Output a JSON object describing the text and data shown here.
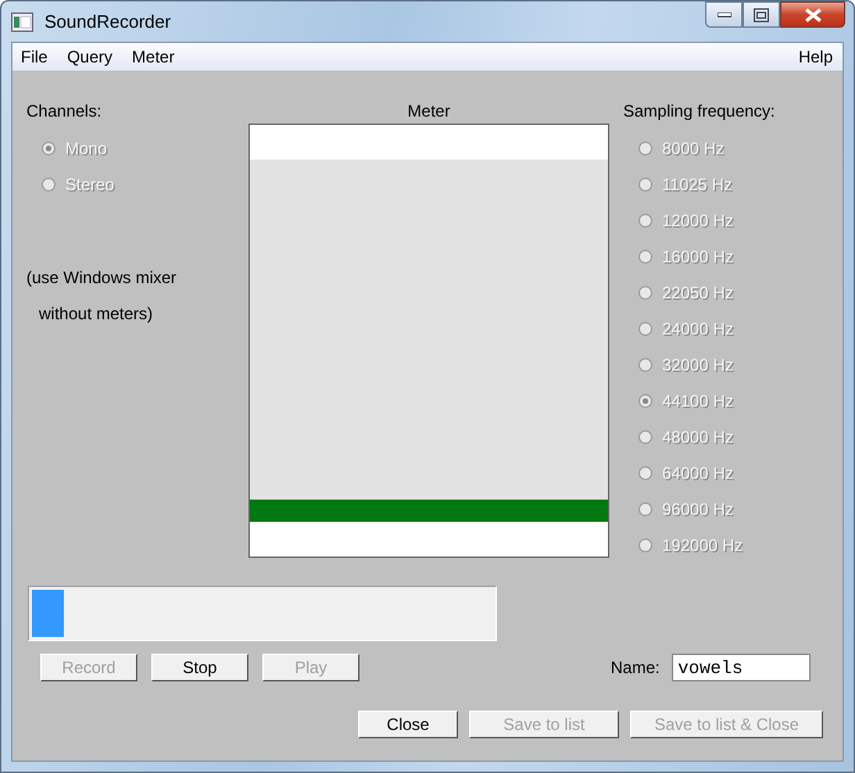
{
  "window": {
    "title": "SoundRecorder"
  },
  "menu": {
    "left": [
      "File",
      "Query",
      "Meter"
    ],
    "right": [
      "Help"
    ]
  },
  "channels": {
    "label": "Channels:",
    "disabled": true,
    "options": [
      {
        "label": "Mono",
        "selected": true
      },
      {
        "label": "Stereo",
        "selected": false
      }
    ],
    "notes": [
      "(use Windows mixer",
      "without meters)"
    ]
  },
  "meter": {
    "label": "Meter"
  },
  "sampling": {
    "label": "Sampling frequency:",
    "disabled": true,
    "options": [
      {
        "label": "8000 Hz",
        "selected": false
      },
      {
        "label": "11025 Hz",
        "selected": false
      },
      {
        "label": "12000 Hz",
        "selected": false
      },
      {
        "label": "16000 Hz",
        "selected": false
      },
      {
        "label": "22050 Hz",
        "selected": false
      },
      {
        "label": "24000 Hz",
        "selected": false
      },
      {
        "label": "32000 Hz",
        "selected": false
      },
      {
        "label": "44100 Hz",
        "selected": true
      },
      {
        "label": "48000 Hz",
        "selected": false
      },
      {
        "label": "64000 Hz",
        "selected": false
      },
      {
        "label": "96000 Hz",
        "selected": false
      },
      {
        "label": "192000 Hz",
        "selected": false
      }
    ]
  },
  "progress": {
    "level": 0.07
  },
  "transport_buttons": [
    {
      "label": "Record",
      "disabled": true
    },
    {
      "label": "Stop",
      "disabled": false
    },
    {
      "label": "Play",
      "disabled": true
    }
  ],
  "name_field": {
    "label": "Name:",
    "value": "vowels"
  },
  "action_buttons": [
    {
      "label": "Close",
      "disabled": false
    },
    {
      "label": "Save to list",
      "disabled": true
    },
    {
      "label": "Save to list & Close",
      "disabled": true
    }
  ]
}
